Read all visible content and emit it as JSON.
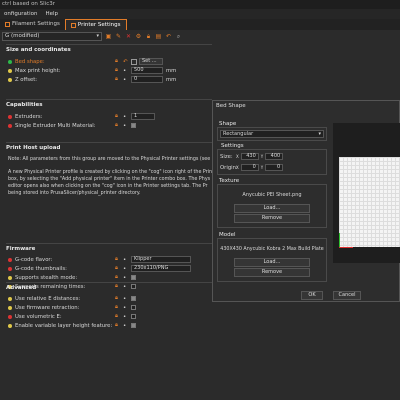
{
  "window": {
    "title": "ctrl based on Slic3r"
  },
  "menu": {
    "items": [
      "onfiguration",
      "Help"
    ]
  },
  "tabs": {
    "filament": "Filament Settings",
    "printer": "Printer Settings"
  },
  "toolbar": {
    "preset": "G (modified)"
  },
  "size_coords": {
    "title": "Size and coordinates",
    "bed_shape": "Bed shape:",
    "set_button": "Set ...",
    "max_height_label": "Max print height:",
    "max_height_value": "500",
    "max_height_unit": "mm",
    "z_offset_label": "Z offset:",
    "z_offset_value": "0",
    "z_offset_unit": "mm"
  },
  "capabilities": {
    "title": "Capabilities",
    "extruders_label": "Extruders:",
    "extruders_value": "1",
    "single_extruder_label": "Single Extruder Multi Material:"
  },
  "print_host": {
    "title": "Print Host upload",
    "note": "Note: All parameters from this group are moved to the Physical Printer settings (see",
    "para1": "A new Physical Printer profile is created by clicking on the \"cog\" icon right of the Printer",
    "para2": "box, by selecting the \"Add physical printer\" item in the Printer combo box. The Phys",
    "para3": "editor opens also when clicking on the \"cog\" icon in the Printer settings tab. The Pr",
    "para4": "being stored into PrusaSlicer/physical_printer directory."
  },
  "firmware": {
    "title": "Firmware",
    "gcode_flavor_label": "G-code flavor:",
    "gcode_flavor_value": "Klipper",
    "thumbnails_label": "G-code thumbnails:",
    "thumbnails_value": "230x110/PNG",
    "stealth_label": "Supports stealth mode:",
    "remaining_label": "Supports remaining times:"
  },
  "advanced": {
    "title": "Advanced",
    "relative_e": "Use relative E distances:",
    "fw_retraction": "Use firmware retraction:",
    "volumetric": "Use volumetric E:",
    "variable_layer": "Enable variable layer height feature:"
  },
  "dialog": {
    "title": "Bed Shape",
    "shape_label": "Shape",
    "shape_value": "Rectangular",
    "settings_label": "Settings",
    "size_label": "Size:",
    "size_x_prefix": "X",
    "size_x": "430",
    "size_y_prefix": "Y",
    "size_y": "400",
    "origin_label": "Origin:",
    "origin_x_prefix": "X",
    "origin_x": "0",
    "origin_y_prefix": "Y",
    "origin_y": "0",
    "texture_label": "Texture",
    "texture_file": "Anycubic PEI Sheet.png",
    "load": "Load...",
    "remove": "Remove",
    "model_label": "Model",
    "model_file": "430X430 Anycubic Kobra 2 Max Build Plate",
    "origin_marker": "(0,0)",
    "ok": "OK",
    "cancel": "Cancel"
  }
}
